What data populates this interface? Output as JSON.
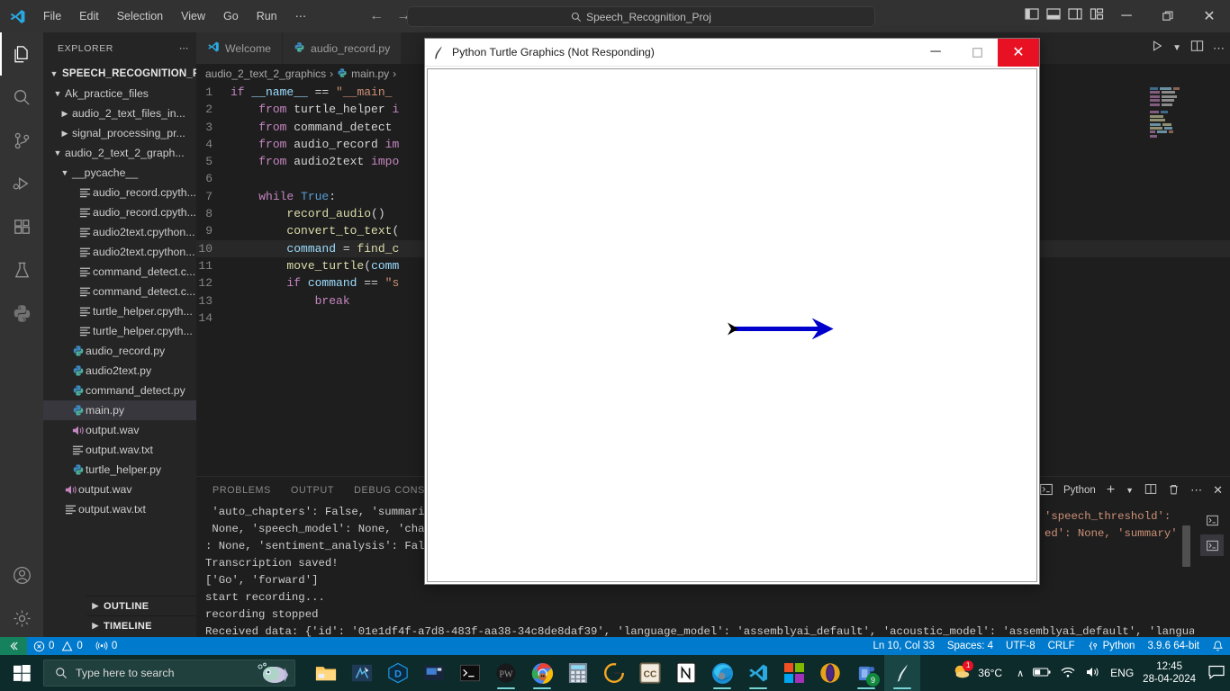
{
  "window": {
    "title_menu": [
      "File",
      "Edit",
      "Selection",
      "View",
      "Go",
      "Run",
      "⋯"
    ],
    "search_value": "Speech_Recognition_Proj",
    "search_icon": "search-icon",
    "back_icon": "←",
    "forward_icon": "→",
    "minimize": "─",
    "maximize": "❐",
    "close": "✕"
  },
  "activitybar": {
    "items": [
      {
        "name": "explorer",
        "icon": "files-icon",
        "active": true
      },
      {
        "name": "search",
        "icon": "search-icon",
        "active": false
      },
      {
        "name": "source-control",
        "icon": "source-control-icon",
        "active": false
      },
      {
        "name": "run-and-debug",
        "icon": "run-debug-icon",
        "active": false
      },
      {
        "name": "extensions",
        "icon": "extensions-icon",
        "active": false
      },
      {
        "name": "testing",
        "icon": "beaker-icon",
        "active": false
      },
      {
        "name": "python",
        "icon": "python-icon",
        "active": false
      }
    ],
    "bottom": [
      {
        "name": "accounts",
        "icon": "account-icon"
      },
      {
        "name": "manage",
        "icon": "gear-icon"
      }
    ]
  },
  "sidebar": {
    "header": "EXPLORER",
    "more_icon": "⋯",
    "root": "SPEECH_RECOGNITION_PR...",
    "items": [
      {
        "label": "Ak_practice_files",
        "type": "folder",
        "depth": 1,
        "expanded": true
      },
      {
        "label": "audio_2_text_files_in...",
        "type": "folder",
        "depth": 2,
        "expanded": false
      },
      {
        "label": "signal_processing_pr...",
        "type": "folder",
        "depth": 2,
        "expanded": false
      },
      {
        "label": "audio_2_text_2_graph...",
        "type": "folder",
        "depth": 1,
        "expanded": true
      },
      {
        "label": "__pycache__",
        "type": "folder",
        "depth": 2,
        "expanded": true
      },
      {
        "label": "audio_record.cpyth...",
        "type": "file-generic",
        "depth": 3
      },
      {
        "label": "audio_record.cpyth...",
        "type": "file-generic",
        "depth": 3
      },
      {
        "label": "audio2text.cpython...",
        "type": "file-generic",
        "depth": 3
      },
      {
        "label": "audio2text.cpython...",
        "type": "file-generic",
        "depth": 3
      },
      {
        "label": "command_detect.c...",
        "type": "file-generic",
        "depth": 3
      },
      {
        "label": "command_detect.c...",
        "type": "file-generic",
        "depth": 3
      },
      {
        "label": "turtle_helper.cpyth...",
        "type": "file-generic",
        "depth": 3
      },
      {
        "label": "turtle_helper.cpyth...",
        "type": "file-generic",
        "depth": 3
      },
      {
        "label": "audio_record.py",
        "type": "python",
        "depth": 2
      },
      {
        "label": "audio2text.py",
        "type": "python",
        "depth": 2
      },
      {
        "label": "command_detect.py",
        "type": "python",
        "depth": 2
      },
      {
        "label": "main.py",
        "type": "python",
        "depth": 2,
        "selected": true
      },
      {
        "label": "output.wav",
        "type": "audio",
        "depth": 2
      },
      {
        "label": "output.wav.txt",
        "type": "file-generic",
        "depth": 2
      },
      {
        "label": "turtle_helper.py",
        "type": "python",
        "depth": 2
      },
      {
        "label": "output.wav",
        "type": "audio",
        "depth": 1
      },
      {
        "label": "output.wav.txt",
        "type": "file-generic",
        "depth": 1
      }
    ],
    "sections": [
      "OUTLINE",
      "TIMELINE"
    ]
  },
  "editor": {
    "tabs": [
      {
        "label": "Welcome",
        "icon": "vscode-icon",
        "active": false
      },
      {
        "label": "audio_record.py",
        "icon": "python-icon",
        "active": false
      }
    ],
    "actions": [
      "run-icon",
      "chevron-down-icon",
      "split-editor-icon",
      "more-icon"
    ],
    "breadcrumb": [
      "audio_2_text_2_graphics",
      "main.py",
      ""
    ],
    "breadcrumb_sep": "›",
    "cursor_line": 10,
    "lines": [
      {
        "n": 1,
        "tokens": [
          {
            "t": "if ",
            "c": "kw"
          },
          {
            "t": "__name__",
            "c": "var"
          },
          {
            "t": " == ",
            "c": "op"
          },
          {
            "t": "\"__main_",
            "c": "str"
          }
        ]
      },
      {
        "n": 2,
        "tokens": [
          {
            "t": "    ",
            "c": "op"
          },
          {
            "t": "from ",
            "c": "kw"
          },
          {
            "t": "turtle_helper",
            "c": "op"
          },
          {
            "t": " i",
            "c": "kw"
          }
        ]
      },
      {
        "n": 3,
        "tokens": [
          {
            "t": "    ",
            "c": "op"
          },
          {
            "t": "from ",
            "c": "kw"
          },
          {
            "t": "command_detect",
            "c": "op"
          }
        ]
      },
      {
        "n": 4,
        "tokens": [
          {
            "t": "    ",
            "c": "op"
          },
          {
            "t": "from ",
            "c": "kw"
          },
          {
            "t": "audio_record",
            "c": "op"
          },
          {
            "t": " im",
            "c": "kw"
          }
        ]
      },
      {
        "n": 5,
        "tokens": [
          {
            "t": "    ",
            "c": "op"
          },
          {
            "t": "from ",
            "c": "kw"
          },
          {
            "t": "audio2text",
            "c": "op"
          },
          {
            "t": " impo",
            "c": "kw"
          }
        ]
      },
      {
        "n": 6,
        "tokens": []
      },
      {
        "n": 7,
        "tokens": [
          {
            "t": "    ",
            "c": "op"
          },
          {
            "t": "while ",
            "c": "kw"
          },
          {
            "t": "True",
            "c": "kw2"
          },
          {
            "t": ":",
            "c": "op"
          }
        ]
      },
      {
        "n": 8,
        "tokens": [
          {
            "t": "        ",
            "c": "op"
          },
          {
            "t": "record_audio",
            "c": "fn"
          },
          {
            "t": "()",
            "c": "op"
          }
        ]
      },
      {
        "n": 9,
        "tokens": [
          {
            "t": "        ",
            "c": "op"
          },
          {
            "t": "convert_to_text",
            "c": "fn"
          },
          {
            "t": "(",
            "c": "op"
          }
        ]
      },
      {
        "n": 10,
        "tokens": [
          {
            "t": "        ",
            "c": "op"
          },
          {
            "t": "command",
            "c": "var"
          },
          {
            "t": " = ",
            "c": "op"
          },
          {
            "t": "find_c",
            "c": "fn"
          }
        ],
        "current": true
      },
      {
        "n": 11,
        "tokens": [
          {
            "t": "        ",
            "c": "op"
          },
          {
            "t": "move_turtle",
            "c": "fn"
          },
          {
            "t": "(",
            "c": "op"
          },
          {
            "t": "comm",
            "c": "var"
          }
        ]
      },
      {
        "n": 12,
        "tokens": [
          {
            "t": "        ",
            "c": "op"
          },
          {
            "t": "if ",
            "c": "kw"
          },
          {
            "t": "command",
            "c": "var"
          },
          {
            "t": " == ",
            "c": "op"
          },
          {
            "t": "\"s",
            "c": "str"
          }
        ]
      },
      {
        "n": 13,
        "tokens": [
          {
            "t": "            ",
            "c": "op"
          },
          {
            "t": "break",
            "c": "kw"
          }
        ]
      },
      {
        "n": 14,
        "tokens": []
      }
    ]
  },
  "panel": {
    "tabs": [
      "PROBLEMS",
      "OUTPUT",
      "DEBUG CONSOLE"
    ],
    "active_tab": "DEBUG CONSOLE",
    "terminal_label": "Python",
    "terminal_icon": "terminal-icon",
    "actions": [
      "add-terminal-icon",
      "chevron-down-icon",
      "split-terminal-icon",
      "trash-icon",
      "more-icon",
      "close-icon"
    ],
    "lines": [
      " 'auto_chapters': False, 'summari",
      " None, 'speech_model': None, 'cha",
      ": None, 'sentiment_analysis': Fal",
      "Transcription saved!",
      "['Go', 'forward']",
      "start recording...",
      "recording stopped",
      "Received data: {'id': '01e1df4f-a7d8-483f-aa38-34c8de8daf39', 'language_model': 'assemblyai_default', 'acoustic_model': 'assemblyai_default', 'language"
    ],
    "right_fragments": [
      "'speech_threshold':",
      "ed': None, 'summary'"
    ]
  },
  "statusbar": {
    "remote_icon": "remote-icon",
    "errors_icon": "error-icon",
    "errors": "0",
    "warnings_icon": "warning-icon",
    "warnings": "0",
    "ports_icon": "radio-tower-icon",
    "ports": "0",
    "position": "Ln 10, Col 33",
    "spaces": "Spaces: 4",
    "encoding": "UTF-8",
    "eol": "CRLF",
    "language": "Python",
    "interpreter": "3.9.6 64-bit",
    "bell_icon": "bell-icon"
  },
  "turtle_window": {
    "title": "Python Turtle Graphics (Not Responding)",
    "icon": "python-feather-icon",
    "minimize": "─",
    "maximize": "☐",
    "close": "✕",
    "drawing": {
      "line_color": "#0000cc",
      "turtle_color": "#000000",
      "description": "blue horizontal arrow drawn left-to-right with turtle cursor at right end"
    }
  },
  "taskbar": {
    "start_icon": "windows-icon",
    "search_placeholder": "Type here to search",
    "search_icon": "search-icon",
    "pinned": [
      {
        "name": "file-explorer",
        "icon": "folder-icon"
      },
      {
        "name": "snip-and-sketch",
        "icon": "snip-icon"
      },
      {
        "name": "docker",
        "icon": "docker-icon"
      },
      {
        "name": "media-player",
        "icon": "media-icon"
      },
      {
        "name": "command-prompt",
        "icon": "cmd-icon"
      },
      {
        "name": "physics-wallah",
        "icon": "pw-icon"
      },
      {
        "name": "google-chrome",
        "icon": "chrome-icon"
      },
      {
        "name": "calculator",
        "icon": "calculator-icon"
      },
      {
        "name": "grammarly",
        "icon": "grammarly-icon"
      },
      {
        "name": "cc-app",
        "icon": "cc-icon"
      },
      {
        "name": "notion",
        "icon": "notion-icon"
      },
      {
        "name": "microsoft-edge",
        "icon": "edge-icon"
      },
      {
        "name": "visual-studio-code",
        "icon": "vscode-icon"
      },
      {
        "name": "microsoft-store",
        "icon": "store-icon"
      },
      {
        "name": "opera",
        "icon": "opera-icon"
      },
      {
        "name": "teams",
        "icon": "teams-icon",
        "badge": "9"
      },
      {
        "name": "python-turtle",
        "icon": "python-feather-icon",
        "active": true
      }
    ],
    "tray": {
      "weather_temp": "36°C",
      "weather_icon": "sun-icon",
      "weather_badge": "1",
      "chevron": "∧",
      "battery_icon": "battery-icon",
      "wifi_icon": "wifi-icon",
      "volume_icon": "volume-icon",
      "language": "ENG",
      "time": "12:45",
      "date": "28-04-2024",
      "notification_icon": "notification-icon"
    }
  },
  "colors": {
    "accent": "#007acc",
    "remote_green": "#16825d",
    "turtle_blue": "#0000cc",
    "close_red": "#e81123"
  }
}
